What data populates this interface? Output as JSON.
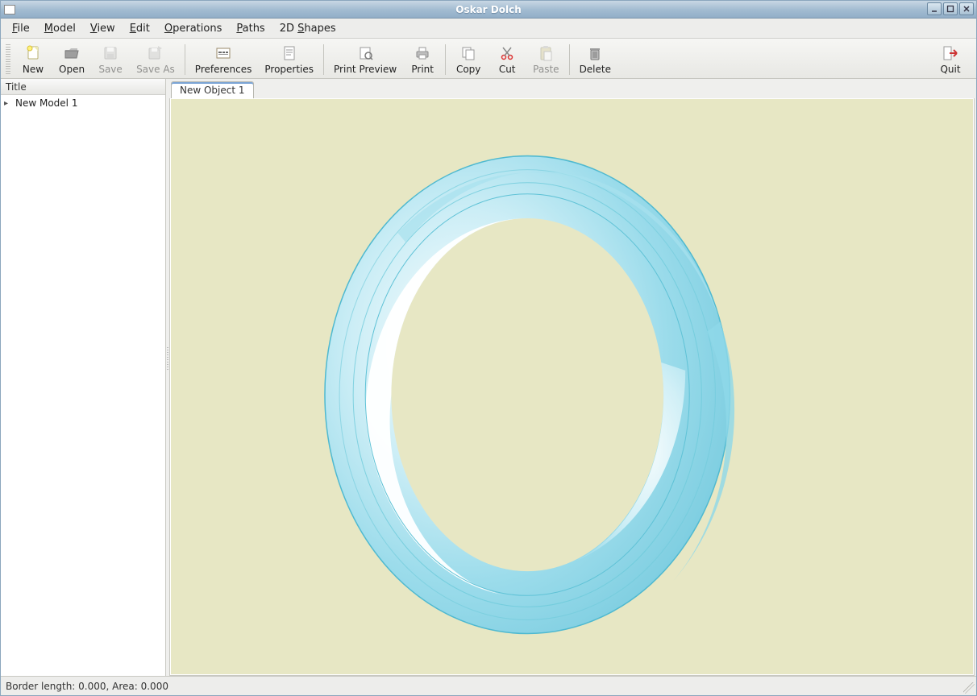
{
  "window": {
    "title": "Oskar Dolch"
  },
  "menu": {
    "items": [
      {
        "label": "File",
        "ul": "F"
      },
      {
        "label": "Model",
        "ul": "M"
      },
      {
        "label": "View",
        "ul": "V"
      },
      {
        "label": "Edit",
        "ul": "E"
      },
      {
        "label": "Operations",
        "ul": "O"
      },
      {
        "label": "Paths",
        "ul": "P"
      },
      {
        "label": "2D Shapes",
        "ul": "S"
      }
    ]
  },
  "toolbar": {
    "new": "New",
    "open": "Open",
    "save": "Save",
    "save_as": "Save As",
    "preferences": "Preferences",
    "properties": "Properties",
    "print_preview": "Print Preview",
    "print": "Print",
    "copy": "Copy",
    "cut": "Cut",
    "paste": "Paste",
    "delete": "Delete",
    "quit": "Quit"
  },
  "sidebar": {
    "header": "Title",
    "items": [
      {
        "label": "New Model 1"
      }
    ]
  },
  "tabs": [
    {
      "label": "New Object 1"
    }
  ],
  "status": {
    "text": "Border length: 0.000, Area: 0.000"
  },
  "colors": {
    "canvas_bg": "#e7e7c4",
    "ring_outline": "#4fb9d0",
    "ring_fill_light": "#bfe9f2",
    "ring_fill_mid": "#8ed8e8",
    "ring_white": "#ffffff"
  }
}
